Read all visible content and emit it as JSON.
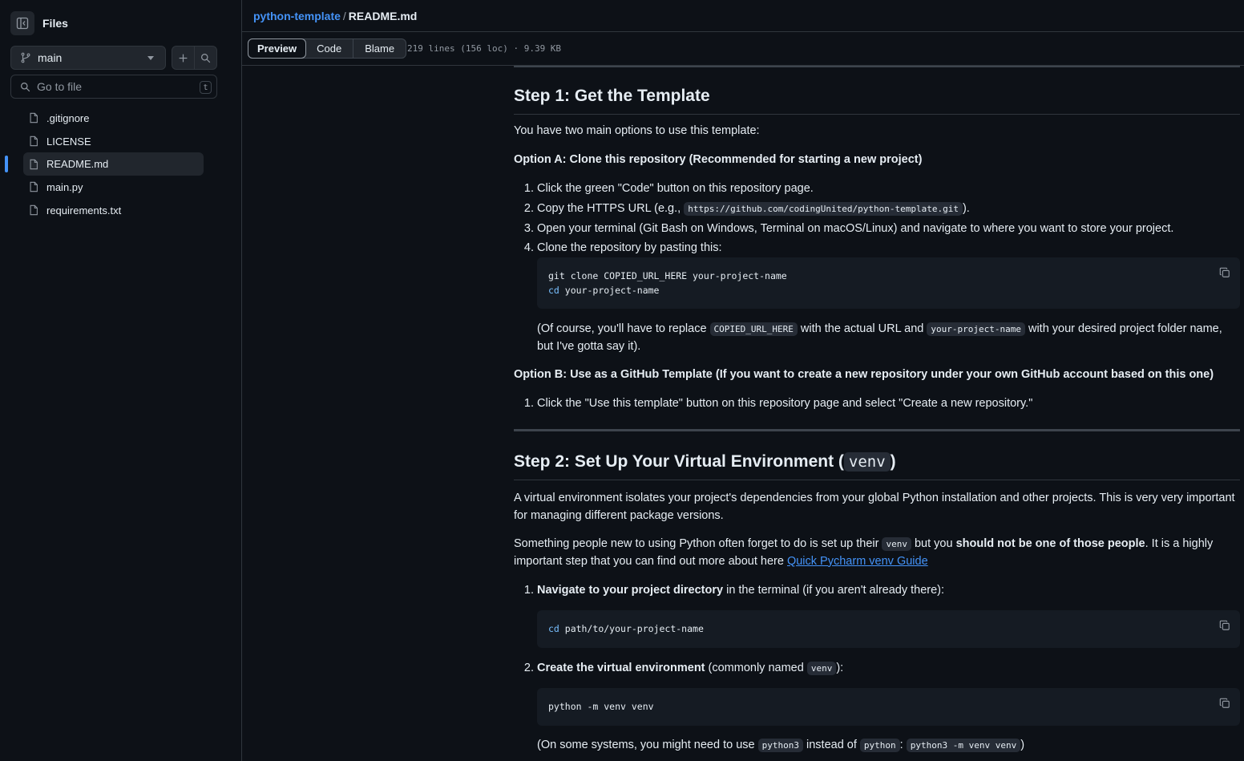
{
  "sidebar": {
    "title": "Files",
    "branch": "main",
    "search_placeholder": "Go to file",
    "search_shortcut": "t",
    "files": [
      {
        "name": ".gitignore"
      },
      {
        "name": "LICENSE"
      },
      {
        "name": "README.md",
        "active": true
      },
      {
        "name": "main.py"
      },
      {
        "name": "requirements.txt"
      }
    ]
  },
  "header": {
    "repo": "python-template",
    "separator": "/",
    "file": "README.md"
  },
  "toolbar": {
    "tabs": [
      "Preview",
      "Code",
      "Blame"
    ],
    "file_info": "219 lines (156 loc) · 9.39 KB"
  },
  "readme": {
    "step1": {
      "title": "Step 1: Get the Template",
      "intro": "You have two main options to use this template:",
      "optionA": "Option A: Clone this repository (Recommended for starting a new project)",
      "a1": "Click the green \"Code\" button on this repository page.",
      "a2_pre": "Copy the HTTPS URL (e.g., ",
      "a2_code": "https://github.com/codingUnited/python-template.git",
      "a2_post": ").",
      "a3": "Open your terminal (Git Bash on Windows, Terminal on macOS/Linux) and navigate to where you want to store your project.",
      "a4": "Clone the repository by pasting this:",
      "code1_line1": "git clone COPIED_URL_HERE your-project-name",
      "code1_kw": "cd",
      "code1_line2": " your-project-name",
      "note_pre": "(Of course, you'll have to replace ",
      "note_code1": "COPIED_URL_HERE",
      "note_mid": " with the actual URL and ",
      "note_code2": "your-project-name",
      "note_post": " with your desired project folder name, but I've gotta say it).",
      "optionB": "Option B: Use as a GitHub Template (If you want to create a new repository under your own GitHub account based on this one)",
      "b1": "Click the \"Use this template\" button on this repository page and select \"Create a new repository.\""
    },
    "step2": {
      "title_pre": "Step 2: Set Up Your Virtual Environment (",
      "title_code": "venv",
      "title_post": ")",
      "p1": "A virtual environment isolates your project's dependencies from your global Python installation and other projects. This is very very important for managing different package versions.",
      "p2_pre": "Something people new to using Python often forget to do is set up their ",
      "p2_code": "venv",
      "p2_mid": " but you ",
      "p2_bold": "should not be one of those people",
      "p2_post": ". It is a highly important step that you can find out more about here ",
      "p2_link": "Quick Pycharm venv Guide",
      "s1_bold": "Navigate to your project directory",
      "s1_rest": " in the terminal (if you aren't already there):",
      "code2_kw": "cd",
      "code2_rest": " path/to/your-project-name",
      "s2_bold": "Create the virtual environment",
      "s2_rest": " (commonly named ",
      "s2_code": "venv",
      "s2_end": "):",
      "code3": "python -m venv venv",
      "note2_pre": "(On some systems, you might need to use ",
      "note2_c1": "python3",
      "note2_mid": " instead of ",
      "note2_c2": "python",
      "note2_colon": ": ",
      "note2_c3": "python3 -m venv venv",
      "note2_end": ")"
    }
  }
}
